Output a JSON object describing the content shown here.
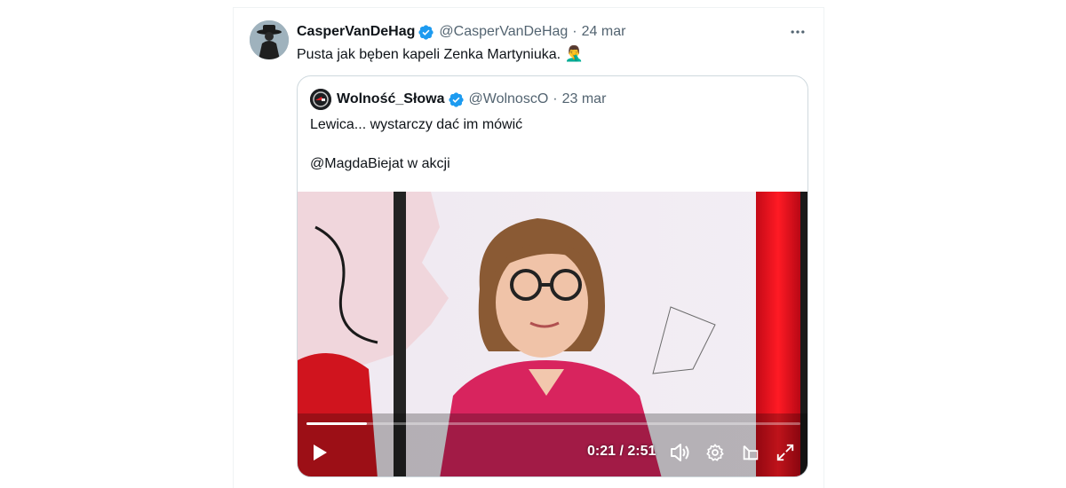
{
  "tweet": {
    "author_name": "CasperVanDeHag",
    "author_handle": "@CasperVanDeHag",
    "separator": "·",
    "date": "24 mar",
    "text": "Pusta jak bęben kapeli Zenka Martyniuka.",
    "emoji": "🤦‍♂️",
    "more_icon": "more-horizontal-icon"
  },
  "quote": {
    "author_name": "Wolność_Słowa",
    "author_handle": "@WolnoscO",
    "separator": "·",
    "date": "23 mar",
    "text_line1": "Lewica... wystarczy dać im mówić",
    "text_line2": "@MagdaBiejat w akcji"
  },
  "video": {
    "current_time": "0:21",
    "duration": "2:51",
    "time_display": "0:21 / 2:51",
    "progress_fraction": 0.123
  },
  "colors": {
    "verified": "#1d9bf0",
    "text_primary": "#0f1419",
    "text_secondary": "#536471",
    "border": "#cfd9de"
  }
}
